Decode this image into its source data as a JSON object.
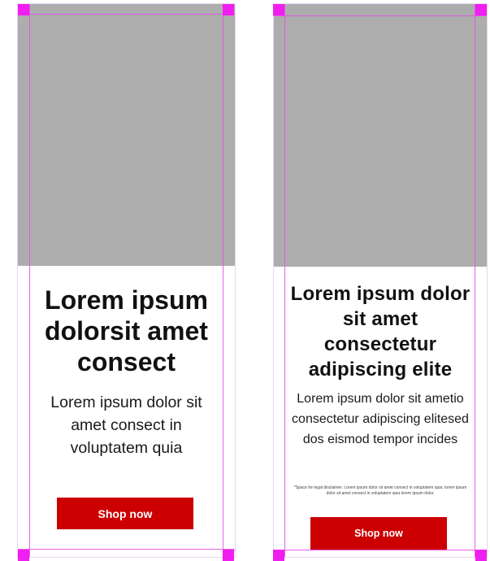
{
  "left_variant": {
    "headline": "Lorem ipsum dolorsit amet consect",
    "body": "Lorem ipsum dolor sit amet consect in voluptatem quia",
    "cta_label": "Shop now"
  },
  "right_variant": {
    "headline": "Lorem ipsum dolor sit amet consectetur adipiscing elite",
    "body": "Lorem ipsum dolor sit ametio consectetur adipiscing elitesed dos eismod tempor incides",
    "disclaimer": "*Space for legal disclaimer. Lorem ipsum dolor sit amet consect in voluptatem quia. lorem ipsum dolor sit amet consect in voluptatem quia lorem ipsum dolor.",
    "cta_label": "Shop now"
  },
  "colors": {
    "image_placeholder": "#adadad",
    "cta_background": "#cc0000",
    "guide_lines": "#e64fe6",
    "corner_markers": "#f01ef0"
  }
}
